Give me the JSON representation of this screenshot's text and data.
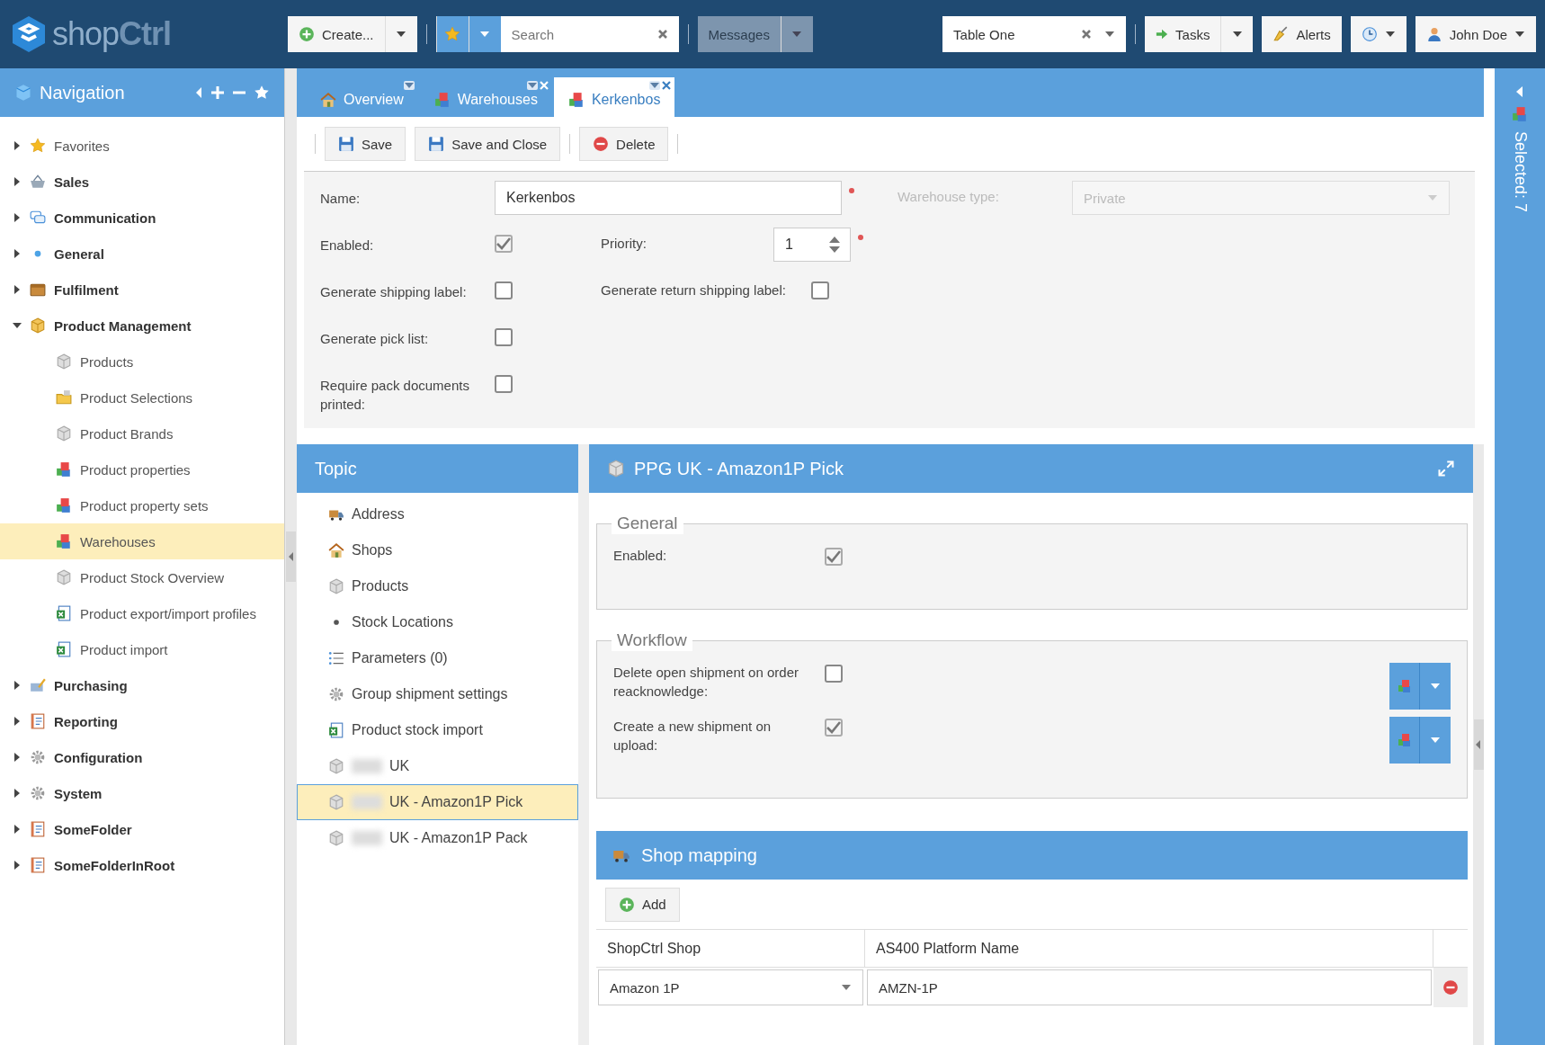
{
  "header": {
    "logo": "shop**Ctrl**",
    "create": "Create...",
    "search": {
      "placeholder": "Search"
    },
    "messages": "Messages",
    "table": "Table One",
    "tasks": "Tasks",
    "alerts": "Alerts",
    "user": "John Doe"
  },
  "navigation": {
    "title": "Navigation",
    "items": [
      {
        "label": "Favorites",
        "bold": false,
        "expanded": false,
        "selected": false
      },
      {
        "label": "Sales",
        "bold": true,
        "expanded": false,
        "selected": false
      },
      {
        "label": "Communication",
        "bold": true,
        "expanded": false,
        "selected": false
      },
      {
        "label": "General",
        "bold": true,
        "expanded": false,
        "selected": false
      },
      {
        "label": "Fulfilment",
        "bold": true,
        "expanded": false,
        "selected": false
      },
      {
        "label": "Product Management",
        "bold": true,
        "expanded": true,
        "selected": false,
        "children": [
          {
            "label": "Products",
            "selected": false
          },
          {
            "label": "Product Selections",
            "selected": false
          },
          {
            "label": "Product Brands",
            "selected": false
          },
          {
            "label": "Product properties",
            "selected": false
          },
          {
            "label": "Product property sets",
            "selected": false
          },
          {
            "label": "Warehouses",
            "selected": true
          },
          {
            "label": "Product Stock Overview",
            "selected": false
          },
          {
            "label": "Product export/import profiles",
            "selected": false
          },
          {
            "label": "Product import",
            "selected": false
          }
        ]
      },
      {
        "label": "Purchasing",
        "bold": true,
        "expanded": false,
        "selected": false
      },
      {
        "label": "Reporting",
        "bold": true,
        "expanded": false,
        "selected": false
      },
      {
        "label": "Configuration",
        "bold": true,
        "expanded": false,
        "selected": false
      },
      {
        "label": "System",
        "bold": true,
        "expanded": false,
        "selected": false
      },
      {
        "label": "SomeFolder",
        "bold": true,
        "expanded": false,
        "selected": false
      },
      {
        "label": "SomeFolderInRoot",
        "bold": true,
        "expanded": false,
        "selected": false
      }
    ]
  },
  "tabs": [
    {
      "label": "Overview",
      "selected": false,
      "closable": false
    },
    {
      "label": "Warehouses",
      "selected": false,
      "closable": true
    },
    {
      "label": "Kerkenbos",
      "selected": true,
      "closable": true
    }
  ],
  "actions": [
    "Save",
    "Save and Close",
    "Delete"
  ],
  "form": {
    "rows": [
      [
        {
          "kind": "text",
          "label": "Name:",
          "value": "Kerkenbos",
          "required": true
        },
        {
          "kind": "select",
          "label": "Warehouse type:",
          "value": "Private",
          "disabled": true
        }
      ],
      [
        {
          "kind": "checkbox",
          "label": "Enabled:",
          "checked": true
        },
        {
          "kind": "spinner",
          "label": "Priority:",
          "value": "1",
          "required": true
        }
      ],
      [
        {
          "kind": "checkbox",
          "label": "Generate shipping label:",
          "checked": false
        },
        {
          "kind": "checkbox",
          "label": "Generate return shipping label:",
          "checked": false
        }
      ],
      [
        {
          "kind": "checkbox",
          "label": "Generate pick list:",
          "checked": false
        }
      ],
      [
        {
          "kind": "checkbox",
          "label": "Require pack documents printed:",
          "checked": false
        }
      ]
    ]
  },
  "topic": {
    "title": "Topic",
    "items": [
      {
        "label": "Address",
        "selected": false,
        "redacted": false
      },
      {
        "label": "Shops",
        "selected": false,
        "redacted": false
      },
      {
        "label": "Products",
        "selected": false,
        "redacted": false
      },
      {
        "label": "Stock Locations",
        "selected": false,
        "redacted": false
      },
      {
        "label": "Parameters (0)",
        "selected": false,
        "redacted": false
      },
      {
        "label": "Group shipment settings",
        "selected": false,
        "redacted": false
      },
      {
        "label": "Product stock import",
        "selected": false,
        "redacted": false
      },
      {
        "label": "UK",
        "selected": false,
        "redacted": true
      },
      {
        "label": "UK - Amazon1P Pick",
        "selected": true,
        "redacted": true
      },
      {
        "label": "UK - Amazon1P Pack",
        "selected": false,
        "redacted": true
      }
    ]
  },
  "detail": {
    "title": "PPG UK - Amazon1P Pick",
    "general": {
      "legend": "General",
      "fields": [
        {
          "label": "Enabled:",
          "checked": true
        }
      ]
    },
    "workflow": {
      "legend": "Workflow",
      "fields": [
        {
          "label": "Delete open shipment on order reacknowledge:",
          "checked": false
        },
        {
          "label": "Create a new shipment on upload:",
          "checked": true
        }
      ]
    },
    "shop_mapping": {
      "title": "Shop mapping",
      "add": "Add",
      "columns": [
        "ShopCtrl Shop",
        "AS400 Platform Name"
      ],
      "rows": [
        {
          "shop": "Amazon 1P",
          "platform": "AMZN-1P"
        }
      ]
    }
  },
  "side_panel": {
    "label": "Selected: 7"
  }
}
